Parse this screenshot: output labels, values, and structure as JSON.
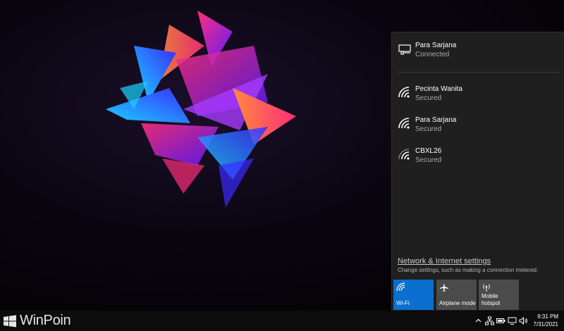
{
  "connected_network": {
    "name": "Para Sarjana",
    "status": "Connected",
    "icon": "ethernet-icon"
  },
  "networks": [
    {
      "name": "Pecinta Wanita",
      "status": "Secured",
      "icon": "wifi-icon"
    },
    {
      "name": "Para Sarjana",
      "status": "Secured",
      "icon": "wifi-icon"
    },
    {
      "name": "CBXL26",
      "status": "Secured",
      "icon": "wifi-icon"
    }
  ],
  "settings": {
    "link": "Network & Internet settings",
    "description": "Change settings, such as making a connection metered."
  },
  "quick_actions": {
    "wifi": {
      "label": "Wi-Fi",
      "active": true,
      "icon": "wifi-icon"
    },
    "airplane": {
      "label": "Airplane mode",
      "active": false,
      "icon": "airplane-icon"
    },
    "hotspot": {
      "label": "Mobile hotspot",
      "active": false,
      "icon": "hotspot-icon"
    }
  },
  "taskbar": {
    "brand": "WinPoin",
    "time": "9:31 PM",
    "date": "7/31/2021",
    "tray_icons": [
      "chevron-up-icon",
      "network-icon",
      "battery-icon",
      "display-icon",
      "volume-icon"
    ]
  },
  "colors": {
    "accent": "#0b6fcf",
    "flyout_bg": "#1f1f1f",
    "tile_inactive": "#4b4b4b"
  }
}
